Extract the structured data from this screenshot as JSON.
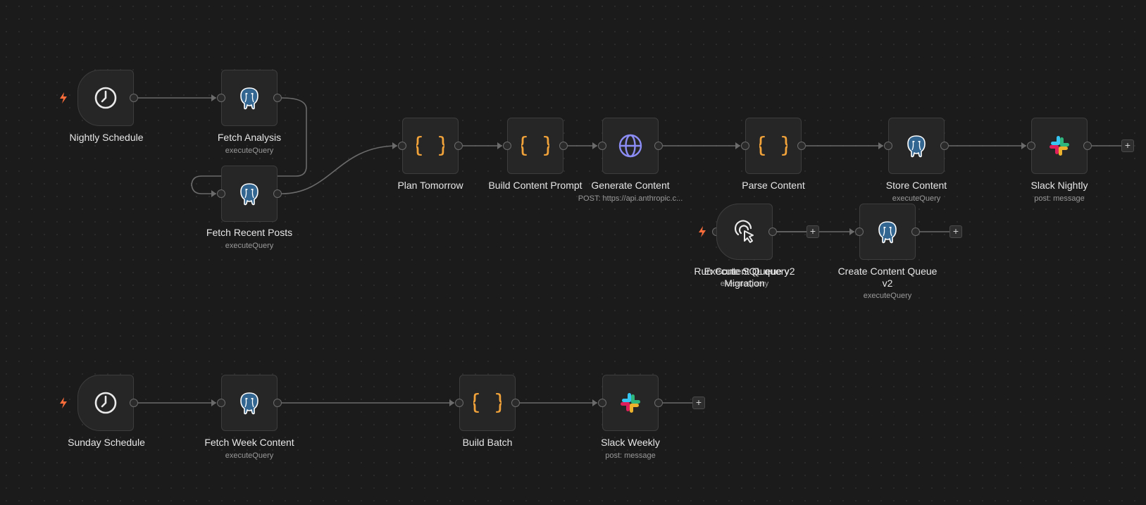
{
  "nodes": {
    "nightly_schedule": {
      "label": "Nightly Schedule",
      "icon": "clock-icon"
    },
    "fetch_analysis": {
      "label": "Fetch Analysis",
      "sub": "executeQuery",
      "icon": "postgres-elephant-icon"
    },
    "fetch_recent_posts": {
      "label": "Fetch Recent Posts",
      "sub": "executeQuery",
      "icon": "postgres-elephant-icon"
    },
    "plan_tomorrow": {
      "label": "Plan Tomorrow",
      "icon": "code-braces-icon"
    },
    "build_content_prompt": {
      "label": "Build Content Prompt",
      "icon": "code-braces-icon"
    },
    "generate_content": {
      "label": "Generate Content",
      "sub": "POST: https://api.anthropic.c...",
      "icon": "globe-icon"
    },
    "parse_content": {
      "label": "Parse Content",
      "icon": "code-braces-icon"
    },
    "store_content": {
      "label": "Store Content",
      "sub": "executeQuery",
      "icon": "postgres-elephant-icon"
    },
    "slack_nightly": {
      "label": "Slack Nightly",
      "sub": "post: message",
      "icon": "slack-icon"
    },
    "run_content_queue_migration": {
      "label": "Run Content Queue v2",
      "label2": "Migration",
      "icon": "cursor-click-icon"
    },
    "execute_sql_query": {
      "label": "Execute SQL query",
      "sub": "executeQuery"
    },
    "create_content_queue": {
      "label": "Create Content Queue",
      "label2": "v2",
      "sub": "executeQuery",
      "icon": "postgres-elephant-icon"
    },
    "sunday_schedule": {
      "label": "Sunday Schedule",
      "icon": "clock-icon"
    },
    "fetch_week_content": {
      "label": "Fetch Week Content",
      "sub": "executeQuery",
      "icon": "postgres-elephant-icon"
    },
    "build_batch": {
      "label": "Build Batch",
      "icon": "code-braces-icon"
    },
    "slack_weekly": {
      "label": "Slack Weekly",
      "sub": "post: message",
      "icon": "slack-icon"
    }
  },
  "add_button_label": "+",
  "colors": {
    "canvas_bg": "#1b1b1c",
    "node_bg": "#262626",
    "node_border": "#3d3d3d",
    "edge": "#6b6b6b",
    "trigger_bolt": "#ff6d3a",
    "code_braces": "#f2a33a",
    "globe": "#8c8cf5",
    "label": "#e6e6e6",
    "sublabel": "#9a9a9a"
  }
}
